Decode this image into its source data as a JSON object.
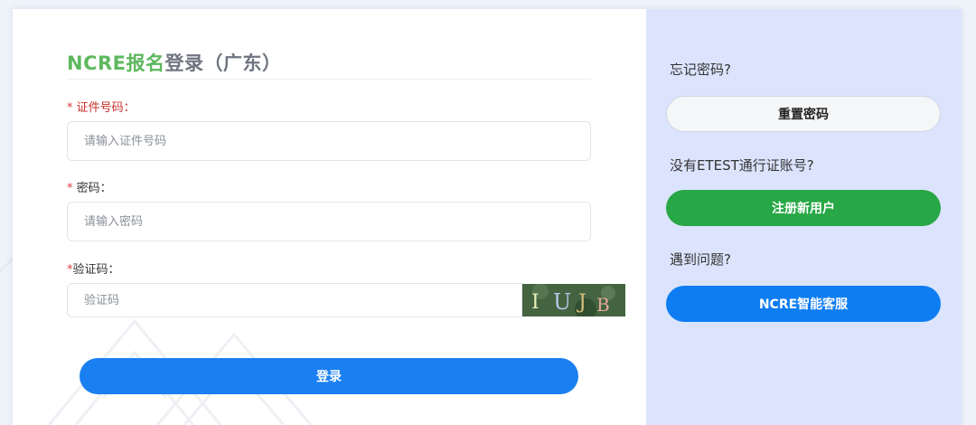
{
  "page": {
    "title_part1": "NCRE报名",
    "title_part2": "登录（广东）"
  },
  "form": {
    "id_label": "证件号码",
    "id_placeholder": "请输入证件号码",
    "password_label": "密码",
    "password_placeholder": "请输入密码",
    "captcha_label": "验证码",
    "captcha_placeholder": "验证码",
    "required_mark": "*",
    "colon": "：",
    "captcha_text": "I U J B",
    "login_button": "登录"
  },
  "side": {
    "forgot_question": "忘记密码?",
    "reset_button": "重置密码",
    "no_account_question": "没有ETEST通行证账号?",
    "register_button": "注册新用户",
    "problem_question": "遇到问题?",
    "service_button": "NCRE智能客服"
  },
  "colors": {
    "title_green": "#5eb85e",
    "login_blue": "#1a7ff0",
    "register_green": "#27a745",
    "service_blue": "#0e7df2",
    "side_panel_bg": "#dbe4fc"
  }
}
